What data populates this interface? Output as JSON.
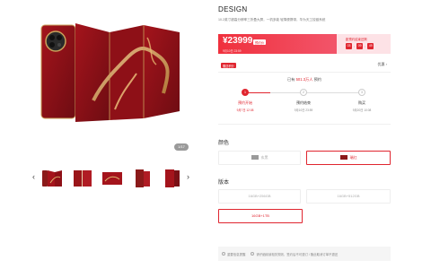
{
  "product": {
    "title": "DESIGN",
    "subtitle": "10.2英寸超高分辨率三折叠大屏，一机多能 轻薄便携带，华为天工铰链系统"
  },
  "price": {
    "amount": "¥23999",
    "badge": "预约价",
    "note": "9月10日 23:59",
    "countdown_label": "距预约结束还剩",
    "countdown": [
      "03",
      "09",
      "49"
    ]
  },
  "promotions": {
    "tag": "赠送积分",
    "more": "优惠 ›"
  },
  "reservation": {
    "prefix": "已有",
    "count": "501.3万人",
    "suffix": "预约",
    "steps": [
      {
        "number": "1",
        "name": "预约开始",
        "time": "9月7日 12:08"
      },
      {
        "number": "2",
        "name": "预约结束",
        "time": "9月10日 23:59"
      },
      {
        "number": "3",
        "name": "购买",
        "time": "9月20日 10:08"
      }
    ]
  },
  "gallery": {
    "counter": "1/17",
    "prev_arrow": "‹",
    "next_arrow": "›"
  },
  "color": {
    "label": "颜色",
    "options": [
      {
        "name": "玄黑",
        "swatch": "#3a3a3a",
        "selected": false
      },
      {
        "name": "瑞红",
        "swatch": "#8b1a1a",
        "selected": true
      }
    ]
  },
  "version": {
    "label": "版本",
    "options": [
      {
        "name": "16GB+256GB",
        "selected": false
      },
      {
        "name": "16GB+512GB",
        "selected": false
      },
      {
        "name": "16GB+1TB",
        "selected": true
      }
    ]
  },
  "notice": {
    "items": [
      "重要信息提醒",
      "请仔细阅读相关规则，签约后不可退订 / 随此取消订单不退还"
    ]
  },
  "colors": {
    "accent": "#e0252f",
    "price_gradient_start": "#f0303d",
    "price_gradient_end": "#f2556a",
    "countdown_bg": "#fde2e6",
    "product_red": "#8b1a1a"
  }
}
